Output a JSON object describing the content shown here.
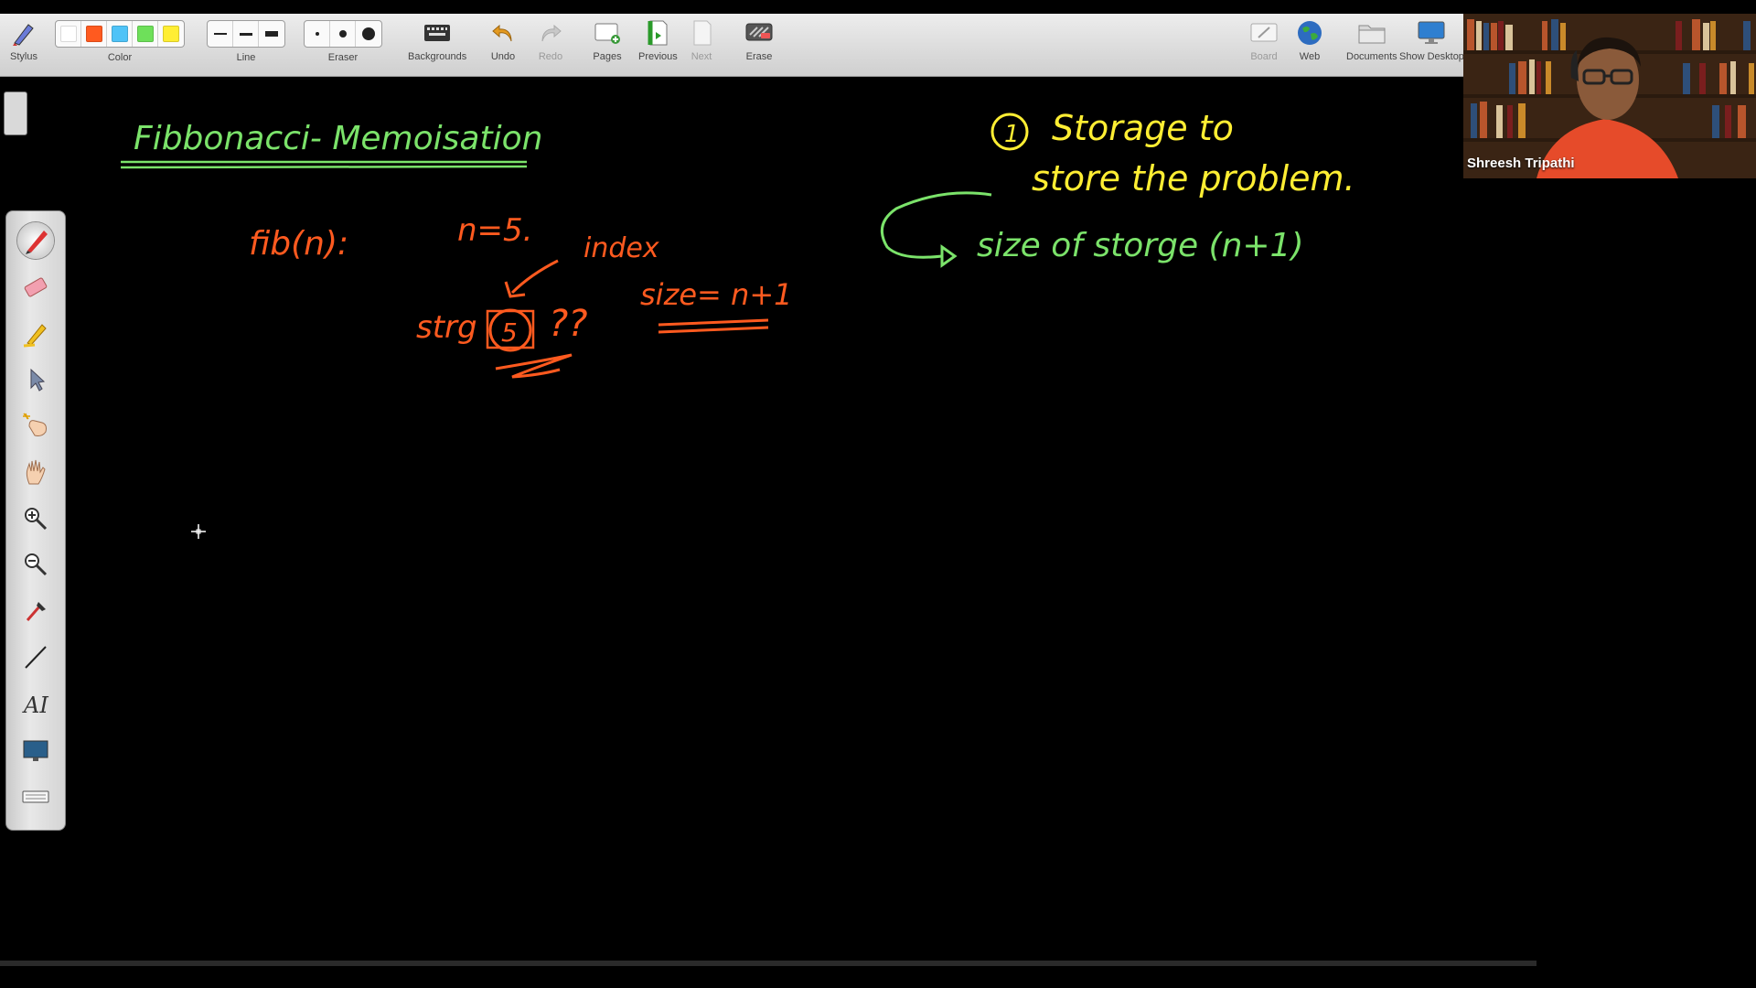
{
  "toolbar": {
    "stylus": "Stylus",
    "color": "Color",
    "line": "Line",
    "eraser": "Eraser",
    "backgrounds": "Backgrounds",
    "undo": "Undo",
    "redo": "Redo",
    "pages": "Pages",
    "previous": "Previous",
    "next": "Next",
    "erase": "Erase",
    "board": "Board",
    "web": "Web",
    "documents": "Documents",
    "show_desktop": "Show Desktop"
  },
  "colors": [
    "#ffffff",
    "#ff5a1f",
    "#4fc3f7",
    "#6ee05a",
    "#ffee33"
  ],
  "board": {
    "title": "Fibbonacci- Memoisation",
    "fib": "fib(n):",
    "n_eq": "n=5.",
    "index": "index",
    "strg": "strg",
    "five": "5",
    "question": "??",
    "size": "size= n+1",
    "storage_num": "1",
    "storage_line1": "Storage  to",
    "storage_line2": "store the  problem.",
    "size_storage": "size of storge (n+1)"
  },
  "webcam": {
    "name": "Shreesh Tripathi"
  },
  "palette_tools": [
    "pen-icon",
    "eraser-icon",
    "highlighter-icon",
    "pointer-icon",
    "magic-hand-icon",
    "hand-icon",
    "zoom-in-icon",
    "zoom-out-icon",
    "dropper-icon",
    "line-icon",
    "text-icon",
    "screen-icon",
    "keyboard-icon"
  ]
}
